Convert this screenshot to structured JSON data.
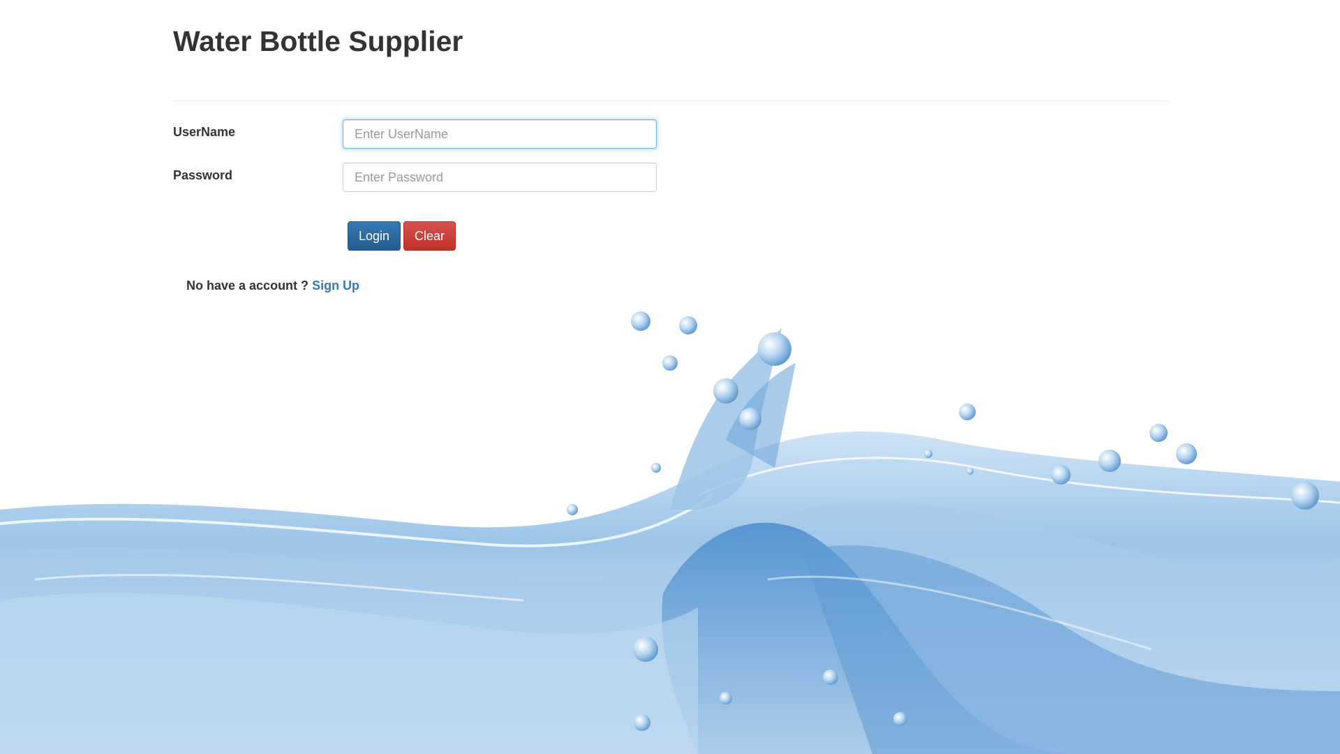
{
  "header": {
    "title": "Water Bottle Supplier"
  },
  "form": {
    "username": {
      "label": "UserName",
      "placeholder": "Enter UserName",
      "value": ""
    },
    "password": {
      "label": "Password",
      "placeholder": "Enter Password",
      "value": ""
    },
    "login_label": "Login",
    "clear_label": "Clear"
  },
  "signup": {
    "prompt": "No have a account ?",
    "link_label": "Sign Up"
  },
  "colors": {
    "primary": "#337ab7",
    "danger": "#d9534f",
    "water_light": "#dcebf8",
    "water_mid": "#7fb0dc",
    "water_dark": "#2e6fb0"
  },
  "decor": {
    "background_image": "water-splash"
  }
}
